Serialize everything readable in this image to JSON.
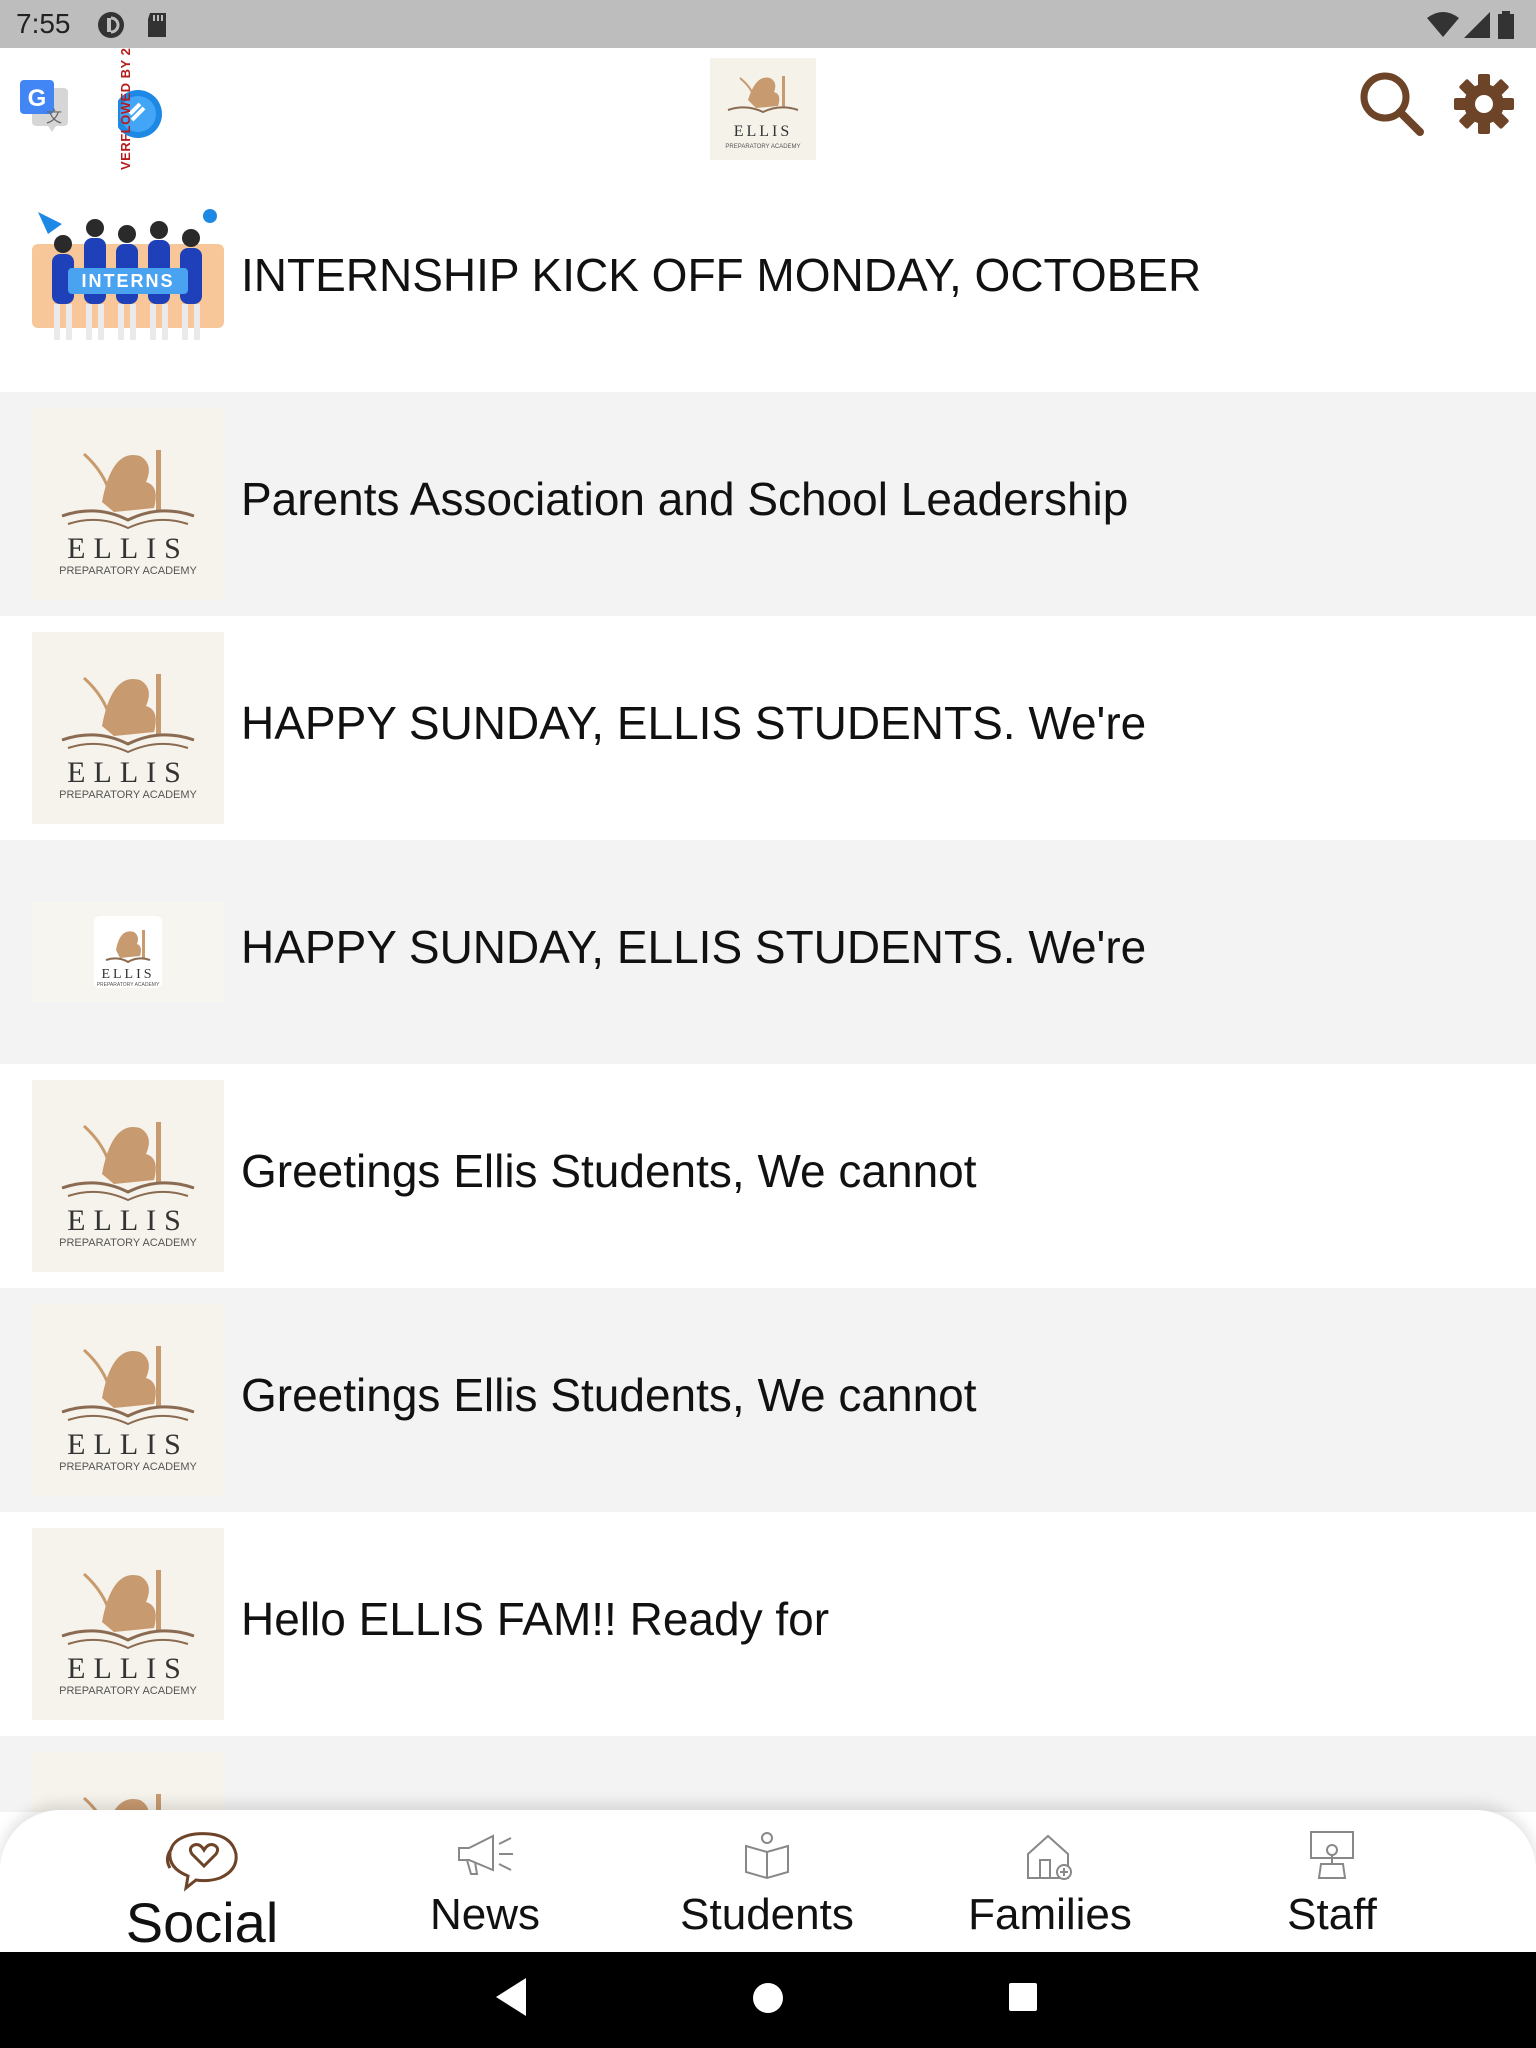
{
  "status_bar": {
    "time": "7:55"
  },
  "app_bar": {
    "overflow_badge": "VERFLOWED BY 2",
    "brand_logo_text": "ELLIS",
    "brand_logo_subtext": "PREPARATORY ACADEMY"
  },
  "feed": {
    "items": [
      {
        "title": "INTERNSHIP KICK OFF MONDAY, OCTOBER",
        "thumbnail": "interns-illustration",
        "thumb_text": "INTERNS"
      },
      {
        "title": "Parents Association and School Leadership",
        "thumbnail": "ellis-logo",
        "thumb_text": "ELLIS",
        "thumb_subtext": "PREPARATORY ACADEMY"
      },
      {
        "title": "HAPPY SUNDAY, ELLIS STUDENTS. We're",
        "thumbnail": "ellis-logo",
        "thumb_text": "ELLIS",
        "thumb_subtext": "PREPARATORY ACADEMY"
      },
      {
        "title": "HAPPY SUNDAY, ELLIS STUDENTS. We're",
        "thumbnail": "ellis-logo-small",
        "thumb_text": "ELLIS",
        "thumb_subtext": "PREPARATORY ACADEMY"
      },
      {
        "title": "Greetings Ellis Students, We cannot",
        "thumbnail": "ellis-logo",
        "thumb_text": "ELLIS",
        "thumb_subtext": "PREPARATORY ACADEMY"
      },
      {
        "title": "Greetings Ellis Students, We cannot",
        "thumbnail": "ellis-logo",
        "thumb_text": "ELLIS",
        "thumb_subtext": "PREPARATORY ACADEMY"
      },
      {
        "title": "Hello ELLIS FAM!! Ready for",
        "thumbnail": "ellis-logo",
        "thumb_text": "ELLIS",
        "thumb_subtext": "PREPARATORY ACADEMY"
      },
      {
        "title": "",
        "thumbnail": "ellis-logo",
        "thumb_text": "",
        "thumb_subtext": ""
      }
    ]
  },
  "bottom_nav": {
    "tabs": [
      {
        "label": "Social",
        "icon": "heart-chat-icon",
        "active": true
      },
      {
        "label": "News",
        "icon": "megaphone-icon",
        "active": false
      },
      {
        "label": "Students",
        "icon": "book-person-icon",
        "active": false
      },
      {
        "label": "Families",
        "icon": "house-icon",
        "active": false
      },
      {
        "label": "Staff",
        "icon": "desk-teacher-icon",
        "active": false
      }
    ]
  },
  "colors": {
    "accent_brown": "#6d4427",
    "logo_gold": "#b8865b",
    "row_alt": "#f3f3f3",
    "status_bar": "#bdbdbd"
  }
}
